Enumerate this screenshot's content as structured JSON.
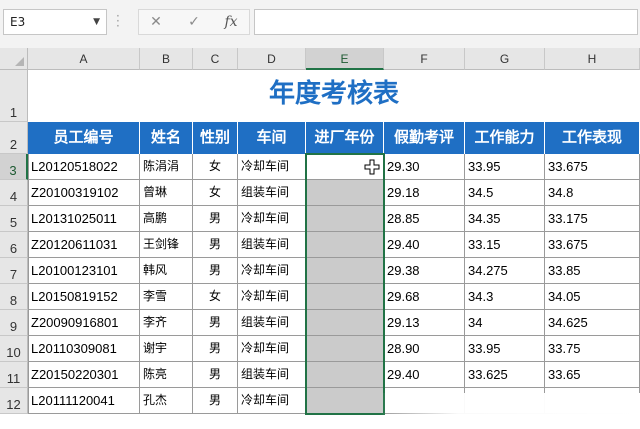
{
  "name_box": {
    "value": "E3"
  },
  "formula_bar": {
    "cancel_glyph": "✕",
    "confirm_glyph": "✓",
    "fx_label": "fx",
    "value": ""
  },
  "columns": [
    "A",
    "B",
    "C",
    "D",
    "E",
    "F",
    "G",
    "H"
  ],
  "rows": [
    "1",
    "2",
    "3",
    "4",
    "5",
    "6",
    "7",
    "8",
    "9",
    "10",
    "11",
    "12"
  ],
  "selected_cell": "E3",
  "sheet": {
    "title": "年度考核表",
    "headers": [
      "员工编号",
      "姓名",
      "性别",
      "车间",
      "进厂年份",
      "假勤考评",
      "工作能力",
      "工作表现"
    ],
    "records": [
      [
        "L20120518022",
        "陈涓涓",
        "女",
        "冷却车间",
        "",
        "29.30",
        "33.95",
        "33.675"
      ],
      [
        "Z20100319102",
        "曾琳",
        "女",
        "组装车间",
        "",
        "29.18",
        "34.5",
        "34.8"
      ],
      [
        "L20131025011",
        "高鹏",
        "男",
        "冷却车间",
        "",
        "28.85",
        "34.35",
        "33.175"
      ],
      [
        "Z20120611031",
        "王剑锋",
        "男",
        "组装车间",
        "",
        "29.40",
        "33.15",
        "33.675"
      ],
      [
        "L20100123101",
        "韩风",
        "男",
        "冷却车间",
        "",
        "29.38",
        "34.275",
        "33.85"
      ],
      [
        "L20150819152",
        "李雪",
        "女",
        "冷却车间",
        "",
        "29.68",
        "34.3",
        "34.05"
      ],
      [
        "Z20090916801",
        "李齐",
        "男",
        "组装车间",
        "",
        "29.13",
        "34",
        "34.625"
      ],
      [
        "L20110309081",
        "谢宇",
        "男",
        "冷却车间",
        "",
        "28.90",
        "33.95",
        "33.75"
      ],
      [
        "Z20150220301",
        "陈亮",
        "男",
        "组装车间",
        "",
        "29.40",
        "33.625",
        "33.65"
      ],
      [
        "L20111120041",
        "孔杰",
        "男",
        "冷却车间",
        "",
        "",
        "",
        ""
      ]
    ]
  },
  "colors": {
    "header_bg": "#1f6fc4",
    "title": "#1f6fc4",
    "selection": "#217346",
    "empty_fill": "#cbcbcb"
  },
  "icons": {
    "cursor": "cell-cursor-icon"
  }
}
